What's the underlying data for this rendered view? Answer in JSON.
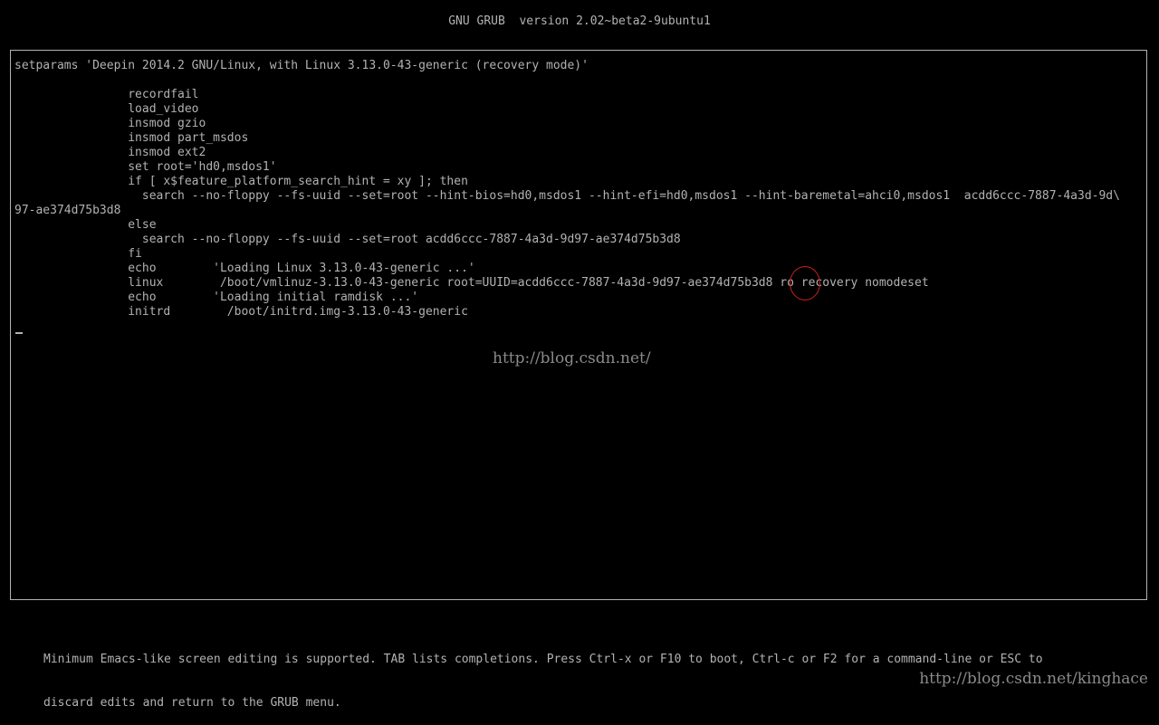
{
  "header": {
    "title": "GNU GRUB  version 2.02~beta2-9ubuntu1"
  },
  "editor": {
    "lines": [
      "setparams 'Deepin 2014.2 GNU/Linux, with Linux 3.13.0-43-generic (recovery mode)'",
      "",
      "                recordfail",
      "                load_video",
      "                insmod gzio",
      "                insmod part_msdos",
      "                insmod ext2",
      "                set root='hd0,msdos1'",
      "                if [ x$feature_platform_search_hint = xy ]; then",
      "                  search --no-floppy --fs-uuid --set=root --hint-bios=hd0,msdos1 --hint-efi=hd0,msdos1 --hint-baremetal=ahci0,msdos1  acdd6ccc-7887-4a3d-9d\\",
      "97-ae374d75b3d8",
      "                else",
      "                  search --no-floppy --fs-uuid --set=root acdd6ccc-7887-4a3d-9d97-ae374d75b3d8",
      "                fi",
      "                echo        'Loading Linux 3.13.0-43-generic ...'",
      "                linux        /boot/vmlinuz-3.13.0-43-generic root=UUID=acdd6ccc-7887-4a3d-9d97-ae374d75b3d8 ro recovery nomodeset",
      "                echo        'Loading initial ramdisk ...'",
      "                initrd        /boot/initrd.img-3.13.0-43-generic"
    ]
  },
  "watermarks": {
    "center": "http://blog.csdn.net/",
    "corner": "http://blog.csdn.net/kinghace"
  },
  "help": {
    "line1": "Minimum Emacs-like screen editing is supported. TAB lists completions. Press Ctrl-x or F10 to boot, Ctrl-c or F2 for a command-line or ESC to",
    "line2": "discard edits and return to the GRUB menu."
  },
  "colors": {
    "text": "#b2b2b2",
    "background": "#000000",
    "annotation": "#d21e1e"
  }
}
